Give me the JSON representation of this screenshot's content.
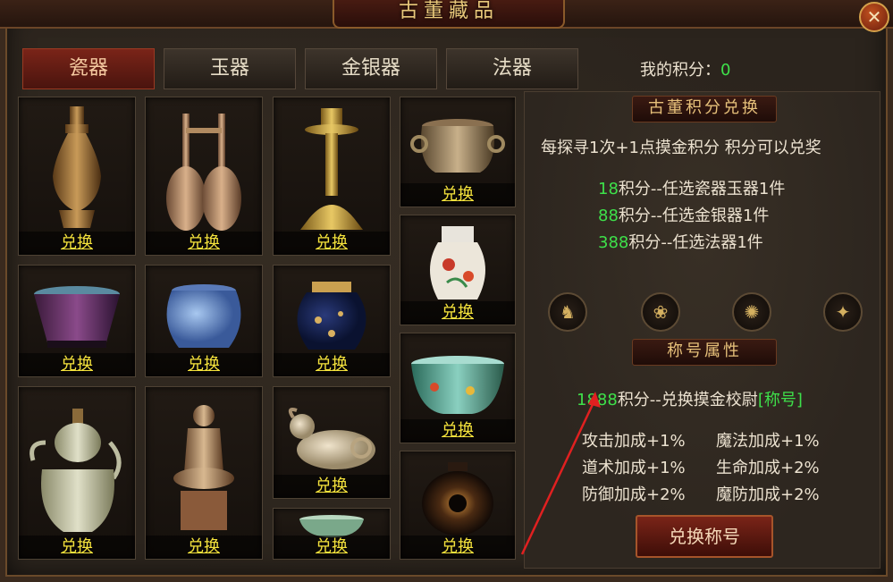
{
  "window": {
    "title": "古董藏品",
    "close_icon": "close-icon"
  },
  "tabs": [
    {
      "label": "瓷器",
      "active": true
    },
    {
      "label": "玉器",
      "active": false
    },
    {
      "label": "金银器",
      "active": false
    },
    {
      "label": "法器",
      "active": false
    }
  ],
  "score": {
    "label": "我的积分：",
    "value": "0"
  },
  "items": [
    {
      "name": "vase-gold-ornate",
      "button": "兑换"
    },
    {
      "name": "twin-dragon-vase",
      "button": "兑换"
    },
    {
      "name": "candle-stand",
      "button": "兑换"
    },
    {
      "name": "bronze-censer",
      "button": "兑换"
    },
    {
      "name": "purple-flared-pot",
      "button": "兑换"
    },
    {
      "name": "blue-jar",
      "button": "兑换"
    },
    {
      "name": "navy-gold-jar",
      "button": "兑换"
    },
    {
      "name": "famille-rose-jar",
      "button": "兑换"
    },
    {
      "name": "celadon-ewer",
      "button": "兑换"
    },
    {
      "name": "buddha-statue",
      "button": "兑换"
    },
    {
      "name": "ram-figurine",
      "button": "兑换"
    },
    {
      "name": "famille-verte-bowl",
      "button": "兑换"
    },
    {
      "name": "celadon-bowl",
      "button": "兑换"
    },
    {
      "name": "black-eye-jar",
      "button": "兑换"
    }
  ],
  "exchange": {
    "heading": "古董积分兑换",
    "intro": "每探寻1次+1点摸金积分    积分可以兑奖",
    "rules": [
      {
        "points": "18",
        "text": "积分--任选瓷器玉器1件"
      },
      {
        "points": "88",
        "text": "积分--任选金银器1件"
      },
      {
        "points": "388",
        "text": "积分--任选法器1件"
      }
    ],
    "icons": [
      "jade-beast-icon",
      "jade-dragon-icon",
      "gold-disc-icon",
      "gold-vajra-icon"
    ]
  },
  "title_attr": {
    "heading": "称号属性",
    "offer_points": "1888",
    "offer_text": "积分--兑换摸金校尉",
    "offer_tag": "[称号]",
    "stats": [
      "攻击加成+1%",
      "魔法加成+1%",
      "道术加成+1%",
      "生命加成+2%",
      "防御加成+2%",
      "魔防加成+2%"
    ],
    "button": "兑换称号"
  },
  "colors": {
    "accent_green": "#3ee04a",
    "button_yellow": "#f4e23c",
    "tab_active": "#7a2418"
  }
}
